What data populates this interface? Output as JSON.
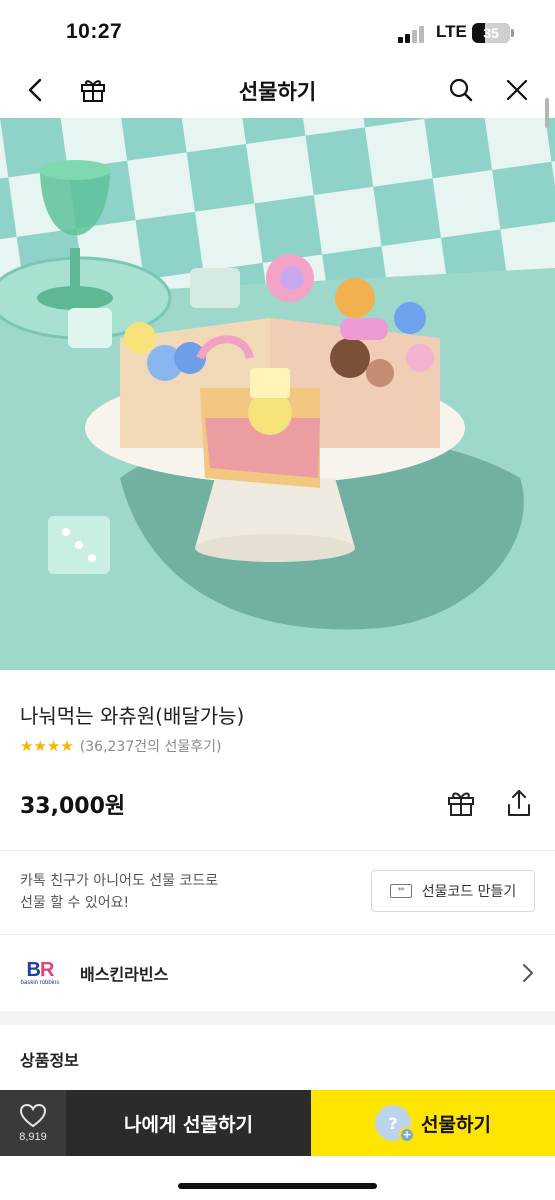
{
  "status_bar": {
    "time": "10:27",
    "network": "LTE",
    "battery": "35",
    "battery_level": 0.35
  },
  "nav": {
    "title": "선물하기",
    "icons": [
      "back-icon",
      "gift-icon",
      "search-icon",
      "close-icon"
    ]
  },
  "product": {
    "title": "나눠먹는 와츄원(배달가능)",
    "stars": "★★★★",
    "rating_value": 4,
    "review_count": "(36,237건의 선물후기)",
    "price": "33,000원"
  },
  "gift_code": {
    "description_line1": "카톡 친구가 아니어도 선물 코드로",
    "description_line2": "선물 할 수 있어요!",
    "button_label": "선물코드 만들기"
  },
  "brand": {
    "logo_text": "BR",
    "logo_sub": "baskin robbins",
    "name": "배스킨라빈스"
  },
  "section": {
    "title": "상품정보"
  },
  "bottom_bar": {
    "like_count": "8,919",
    "self_gift_label": "나에게 선물하기",
    "gift_label": "선물하기"
  },
  "colors": {
    "accent_yellow": "#fee500",
    "dark_button": "#2b2b2b",
    "star": "#f5b400",
    "hero_teal": "#8fd3c8"
  }
}
